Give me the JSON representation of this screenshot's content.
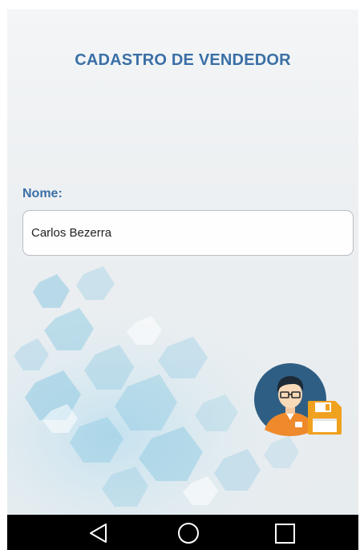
{
  "screen": {
    "title": "CADASTRO DE VENDEDOR"
  },
  "form": {
    "name_label": "Nome:",
    "name_value": "Carlos Bezerra",
    "save_button_icon": "seller-avatar-save-icon"
  },
  "navigation_bar": {
    "back_icon": "back-triangle-icon",
    "home_icon": "home-circle-icon",
    "recents_icon": "recents-square-icon"
  },
  "colors": {
    "accent": "#3a6fa6",
    "avatar_bg": "#2f5e84",
    "floppy": "#f0a11e",
    "navbar": "#000000"
  }
}
